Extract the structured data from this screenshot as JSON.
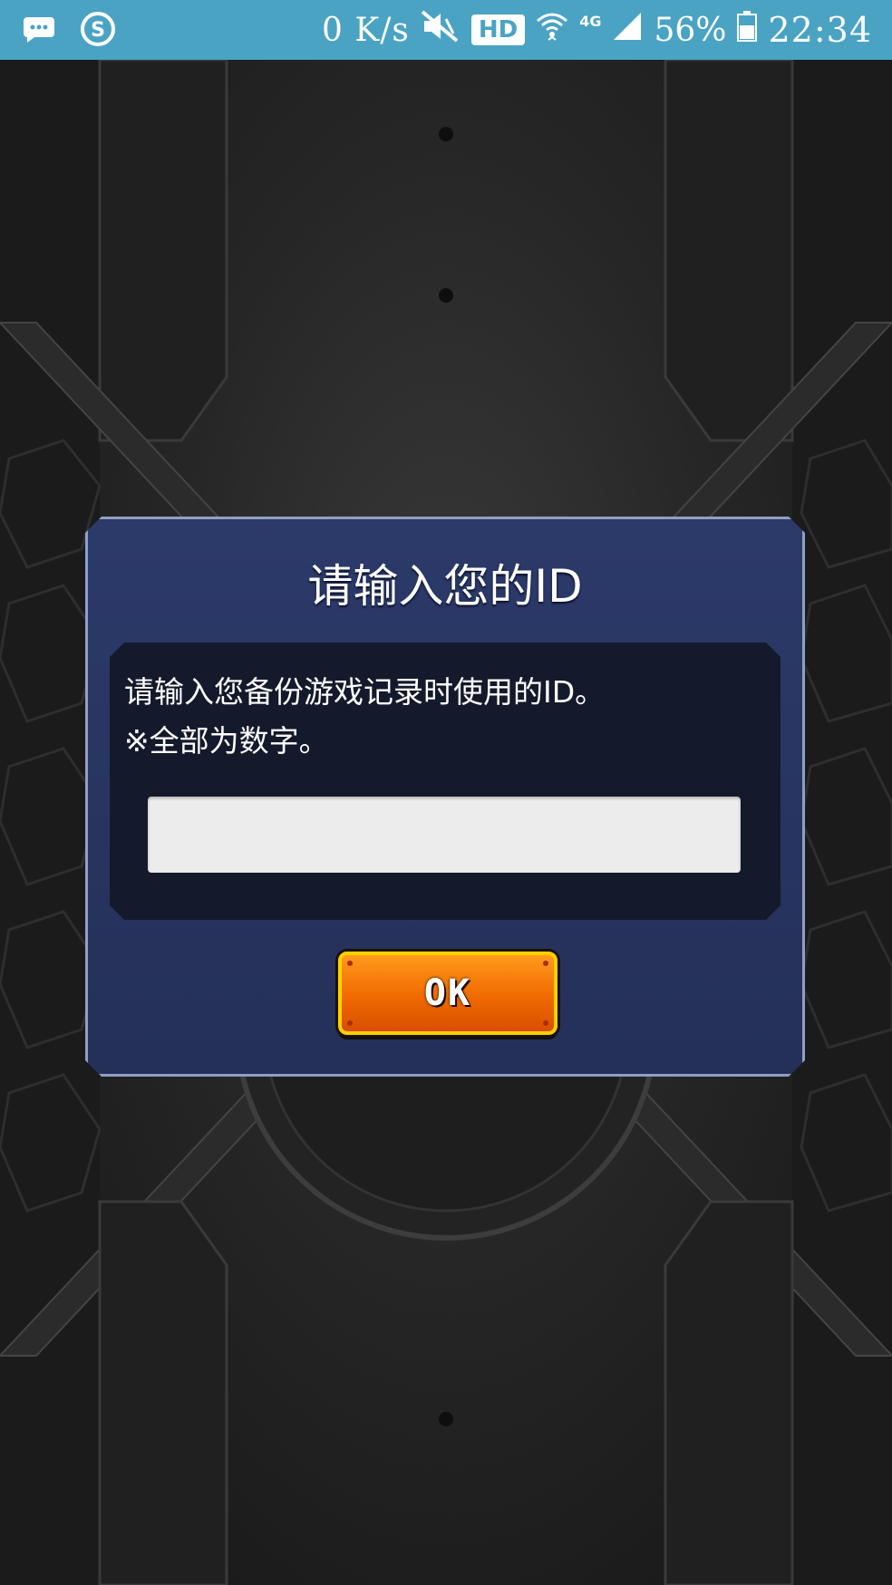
{
  "status_bar": {
    "net_speed": "0 K/s",
    "hd_badge": "HD",
    "network_type": "4G",
    "battery_percent": "56%",
    "time": "22:34",
    "icons": [
      "message-icon",
      "sogou-icon",
      "mute-icon",
      "wifi-icon",
      "signal-icon",
      "battery-icon"
    ],
    "color": "#4aa3c3"
  },
  "dialog": {
    "title": "请输入您的ID",
    "message_line_1": "请输入您备份游戏记录时使用的ID。",
    "message_line_2": "※全部为数字。",
    "id_input": {
      "value": "",
      "placeholder": ""
    },
    "ok_label": "OK",
    "colors": {
      "panel": "#243058",
      "button": "#f06a00",
      "button_border": "#fcd000"
    }
  }
}
